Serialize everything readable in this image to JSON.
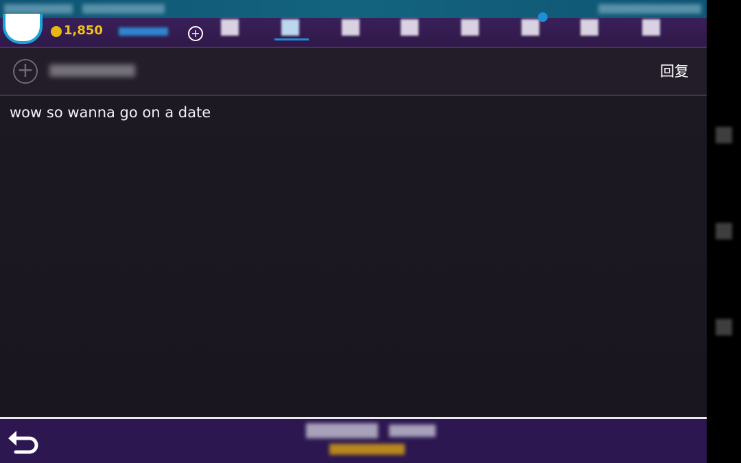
{
  "coins": {
    "count": "1,850"
  },
  "nav": {
    "items": [
      {
        "icon": "profile-icon"
      },
      {
        "icon": "inbox-icon",
        "active": true
      },
      {
        "icon": "friends-icon"
      },
      {
        "icon": "travel-icon"
      },
      {
        "icon": "shop-icon"
      },
      {
        "icon": "gift-box-icon",
        "badge": true
      },
      {
        "icon": "rooms-icon"
      },
      {
        "icon": "more-icon"
      }
    ]
  },
  "message": {
    "reply_label": "回复",
    "body": "wow so wanna go on a date"
  },
  "colors": {
    "nav_bg": "#2f1948",
    "accent": "#1e8fd6",
    "coin": "#f0c21b",
    "body_bg": "#1c1822"
  }
}
